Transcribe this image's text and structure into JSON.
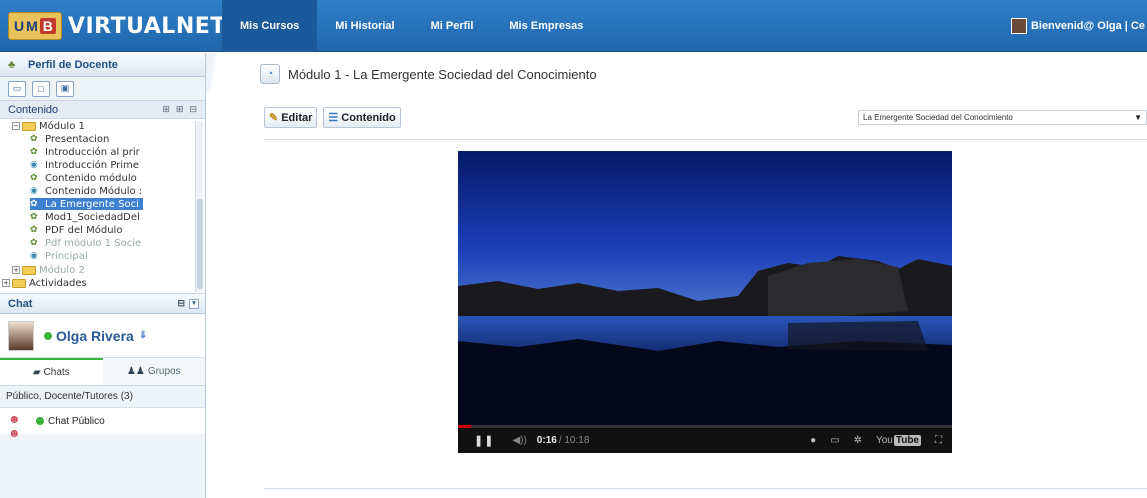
{
  "app": {
    "logo_letters": [
      "U",
      "M",
      "B"
    ],
    "name": "VIRTUALNET 2.0",
    "accent": "#2f7fc9"
  },
  "nav": {
    "items": [
      "Mis Cursos",
      "Mi Historial",
      "Mi Perfil",
      "Mis Empresas"
    ],
    "active": "Mis Cursos"
  },
  "welcome": {
    "text": "Bienvenid@ Olga  |  Ce"
  },
  "sidebar": {
    "profile_title": "Perfil de Docente",
    "content_header": "Contenido",
    "tree": [
      {
        "label": "Módulo 1",
        "type": "folder",
        "level": 1,
        "expanded": true
      },
      {
        "label": "Presentacion",
        "type": "resource",
        "level": 2
      },
      {
        "label": "Introducción al prir",
        "type": "resource",
        "level": 2
      },
      {
        "label": "Introducción Prime",
        "type": "link",
        "level": 2
      },
      {
        "label": "Contenido módulo",
        "type": "resource",
        "level": 2
      },
      {
        "label": "Contenido Módulo :",
        "type": "link",
        "level": 2
      },
      {
        "label": "La Emergente Soci",
        "type": "resource",
        "level": 2,
        "selected": true
      },
      {
        "label": "Mod1_SociedadDel",
        "type": "resource",
        "level": 2
      },
      {
        "label": "PDF del Módulo",
        "type": "resource",
        "level": 2
      },
      {
        "label": "Pdf módulo 1 Socie",
        "type": "resource",
        "level": 2,
        "dim": true
      },
      {
        "label": "Principal",
        "type": "link",
        "level": 2,
        "dim": true
      },
      {
        "label": "Módulo 2",
        "type": "folder",
        "level": 1,
        "dim": true
      },
      {
        "label": "Actividades",
        "type": "folder",
        "level": 0
      }
    ]
  },
  "chat": {
    "title": "Chat",
    "user_name": "Olga Rivera",
    "tabs": [
      "Chats",
      "Grupos"
    ],
    "group_label": "Público, Docente/Tutores (3)",
    "items": [
      "Chat Público"
    ]
  },
  "main": {
    "title": "Módulo 1 - La Emergente Sociedad del Conocimiento",
    "edit_label": "Editar",
    "content_label": "Contenido",
    "select_value": "La Emergente Sociedad del Conocimiento"
  },
  "video": {
    "current_time": "0:16",
    "duration": "/ 10:18",
    "progress": 0.026,
    "brand": "You",
    "brand_box": "Tube"
  }
}
